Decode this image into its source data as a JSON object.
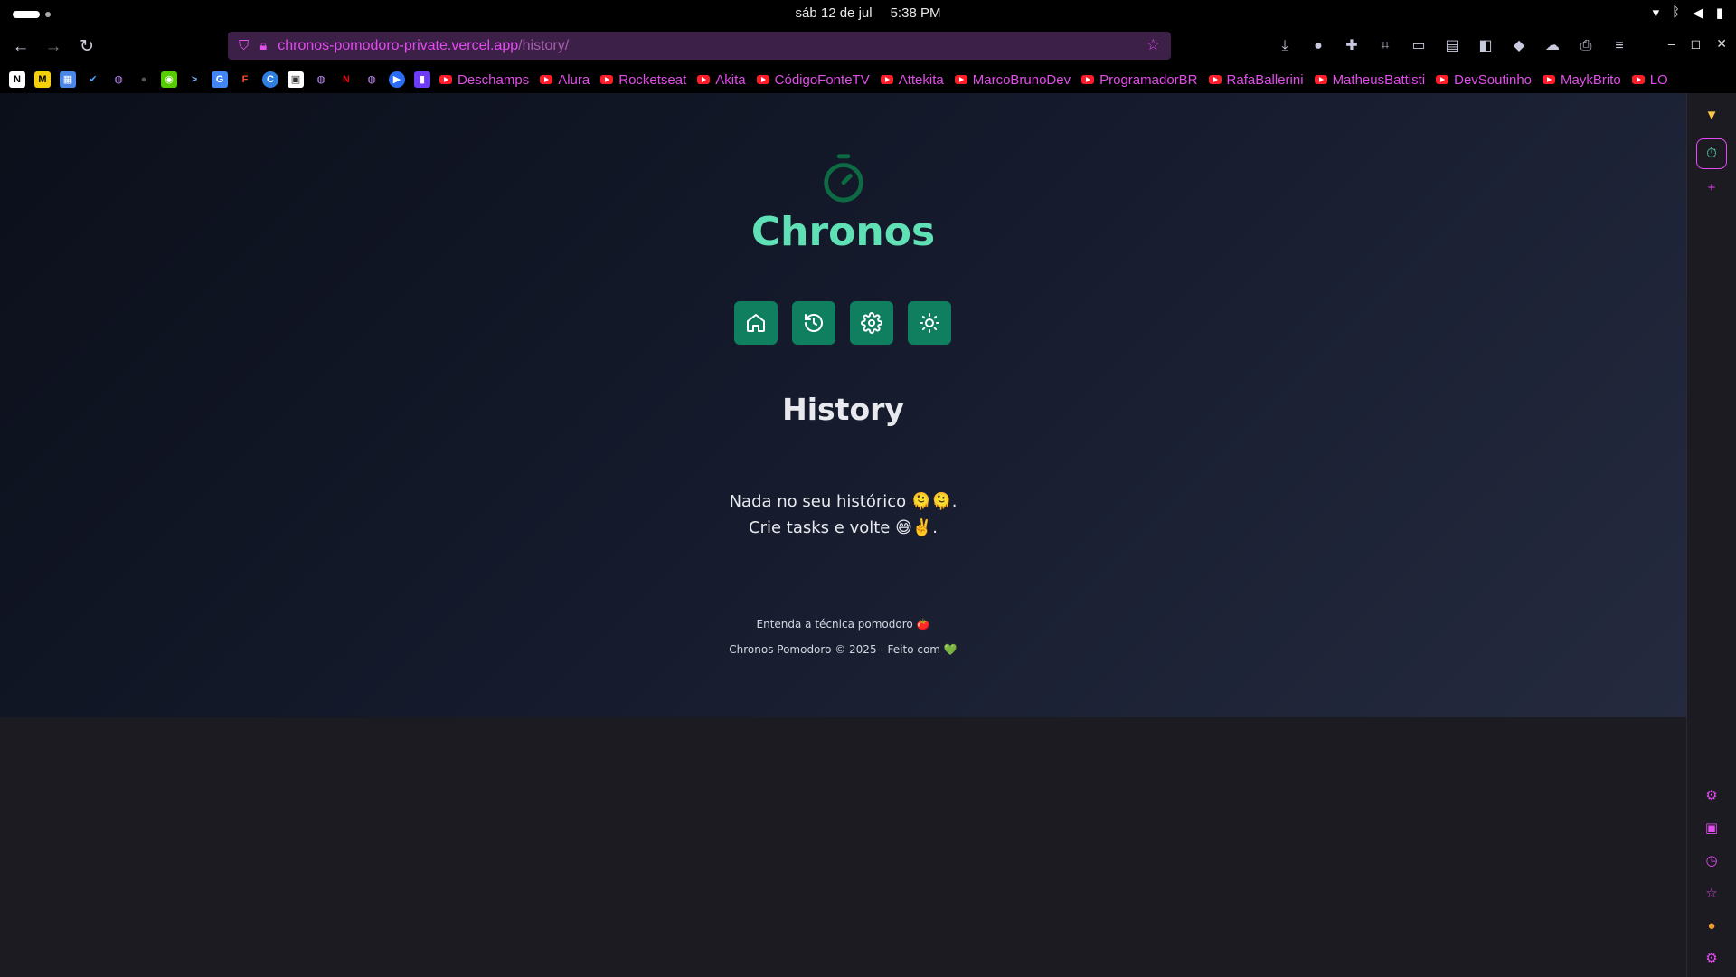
{
  "os": {
    "date": "sáb 12 de jul",
    "time": "5:38 PM"
  },
  "browser": {
    "url_host": "chronos-pomodoro-private.vercel.app",
    "url_path": "/history/",
    "bookmarks": [
      "Deschamps",
      "Alura",
      "Rocketseat",
      "Akita",
      "CódigoFonteTV",
      "Attekita",
      "MarcoBrunoDev",
      "ProgramadorBR",
      "RafaBallerini",
      "MatheusBattisti",
      "DevSoutinho",
      "MaykBrito",
      "LO"
    ]
  },
  "app": {
    "brand": "Chronos",
    "menu": [
      "home-icon",
      "history-icon",
      "settings-icon",
      "sun-icon"
    ],
    "heading": "History",
    "empty_line1": "Nada no seu histórico 🫠🫠.",
    "empty_line2": "Crie tasks e volte 😅✌️.",
    "footer_link": "Entenda a técnica pomodoro 🍅",
    "footer_copy": "Chronos Pomodoro © 2025 - Feito com 💚"
  },
  "colors": {
    "accent": "#5fe0b5",
    "button": "#0f7f5f",
    "browser_accent": "#e24cf0"
  }
}
